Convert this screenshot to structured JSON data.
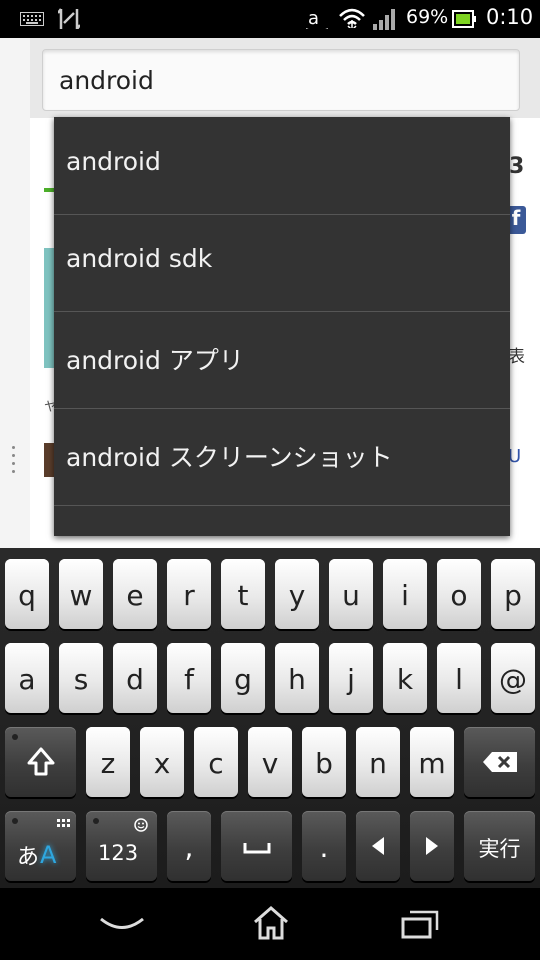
{
  "status_bar": {
    "battery_percent": "69%",
    "time": "0:10",
    "icons": [
      "keyboard-icon",
      "sync-icon",
      "amazon-icon",
      "wifi-icon",
      "signal-icon",
      "battery-icon"
    ]
  },
  "browser": {
    "address_value": "android",
    "page": {
      "side_number": "3",
      "facebook_glyph": "f",
      "side_char_1": "表",
      "side_char_2": "U",
      "side_char_3": "ヤ"
    }
  },
  "suggestions": [
    {
      "label": "android"
    },
    {
      "label": "android sdk"
    },
    {
      "label": "android アプリ"
    },
    {
      "label": "android スクリーンショット"
    }
  ],
  "keyboard": {
    "row1": [
      "q",
      "w",
      "e",
      "r",
      "t",
      "y",
      "u",
      "i",
      "o",
      "p"
    ],
    "row2": [
      "a",
      "s",
      "d",
      "f",
      "g",
      "h",
      "j",
      "k",
      "l",
      "@"
    ],
    "row3": [
      "z",
      "x",
      "c",
      "v",
      "b",
      "n",
      "m"
    ],
    "bottom": {
      "mode_label": "あ",
      "mode_sub": "A",
      "num_label": "123",
      "comma": ",",
      "period": ".",
      "go_label": "実行"
    },
    "colors": {
      "mode_accent": "#2ea7e0"
    }
  },
  "nav_bar": {
    "icons": [
      "back-icon",
      "home-icon",
      "recent-apps-icon"
    ]
  }
}
